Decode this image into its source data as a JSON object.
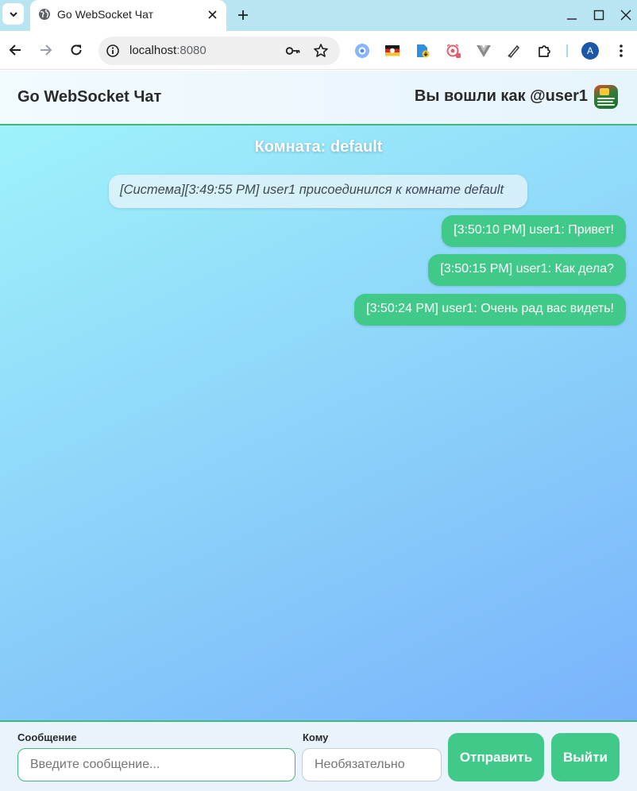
{
  "browser": {
    "tab_title": "Go WebSocket Чат",
    "url_host": "localhost",
    "url_port": ":8080",
    "profile_initial": "A",
    "icons": [
      "tab-list-icon",
      "globe-icon",
      "close-icon",
      "plus-icon",
      "minimize-icon",
      "maximize-icon",
      "back-arrow-icon",
      "forward-arrow-icon",
      "reload-icon",
      "site-info-icon",
      "key-icon",
      "star-icon",
      "extensions-icon",
      "more-menu-icon"
    ]
  },
  "header": {
    "title": "Go WebSocket Чат",
    "user_text": "Вы вошли как @user1"
  },
  "chat": {
    "room_title": "Комната: default",
    "messages": [
      {
        "text": "[Система][3:49:55 PM] user1 присоединился к комнате default",
        "kind": "system"
      },
      {
        "text": "[3:50:10 PM] user1: Привет!",
        "kind": "own"
      },
      {
        "text": "[3:50:15 PM] user1: Как дела?",
        "kind": "own"
      },
      {
        "text": "[3:50:24 PM] user1: Очень рад вас видеть!",
        "kind": "own"
      }
    ]
  },
  "compose": {
    "message_label": "Сообщение",
    "message_placeholder": "Введите сообщение...",
    "to_label": "Кому",
    "to_placeholder": "Необязательно",
    "send_label": "Отправить",
    "exit_label": "Выйти"
  },
  "colors": {
    "accent": "#41c98a",
    "tabbar": "#b9e4f1"
  }
}
